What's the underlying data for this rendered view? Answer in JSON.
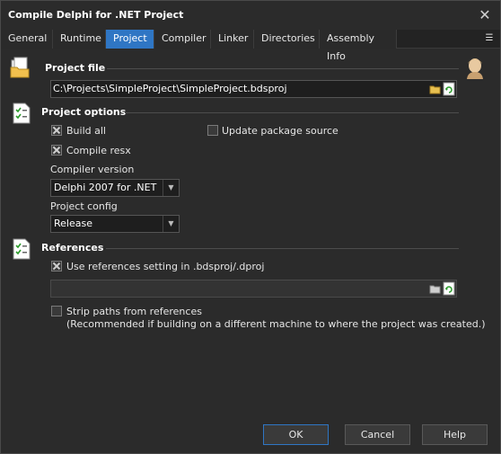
{
  "window": {
    "title": "Compile Delphi for .NET Project"
  },
  "tabs": [
    {
      "label": "General"
    },
    {
      "label": "Runtime"
    },
    {
      "label": "Project",
      "active": true
    },
    {
      "label": "Compiler"
    },
    {
      "label": "Linker"
    },
    {
      "label": "Directories"
    },
    {
      "label": "Assembly Info"
    }
  ],
  "project_file": {
    "title": "Project file",
    "value": "C:\\Projects\\SimpleProject\\SimpleProject.bdsproj"
  },
  "project_options": {
    "title": "Project options",
    "build_all": {
      "label": "Build all",
      "checked": true
    },
    "update_package_source": {
      "label": "Update package source",
      "checked": false
    },
    "compile_resx": {
      "label": "Compile resx",
      "checked": true
    },
    "compiler_version": {
      "label": "Compiler version",
      "value": "Delphi 2007 for .NET"
    },
    "project_config": {
      "label": "Project config",
      "value": "Release"
    }
  },
  "references": {
    "title": "References",
    "use_references": {
      "label": "Use references setting in .bdsproj/.dproj",
      "checked": true
    },
    "path_value": "",
    "strip_paths": {
      "label": "Strip paths from references",
      "checked": false
    },
    "strip_note": "(Recommended if building on a different machine to where the project was created.)"
  },
  "buttons": {
    "ok": "OK",
    "cancel": "Cancel",
    "help": "Help"
  },
  "colors": {
    "accent": "#2f76c4",
    "background": "#2b2b2b",
    "field": "#1e1e1e"
  },
  "icons": [
    "close-icon",
    "menu-icon",
    "folder-icon",
    "checklist-icon",
    "open-folder-icon",
    "refresh-icon",
    "user-avatar-icon"
  ]
}
